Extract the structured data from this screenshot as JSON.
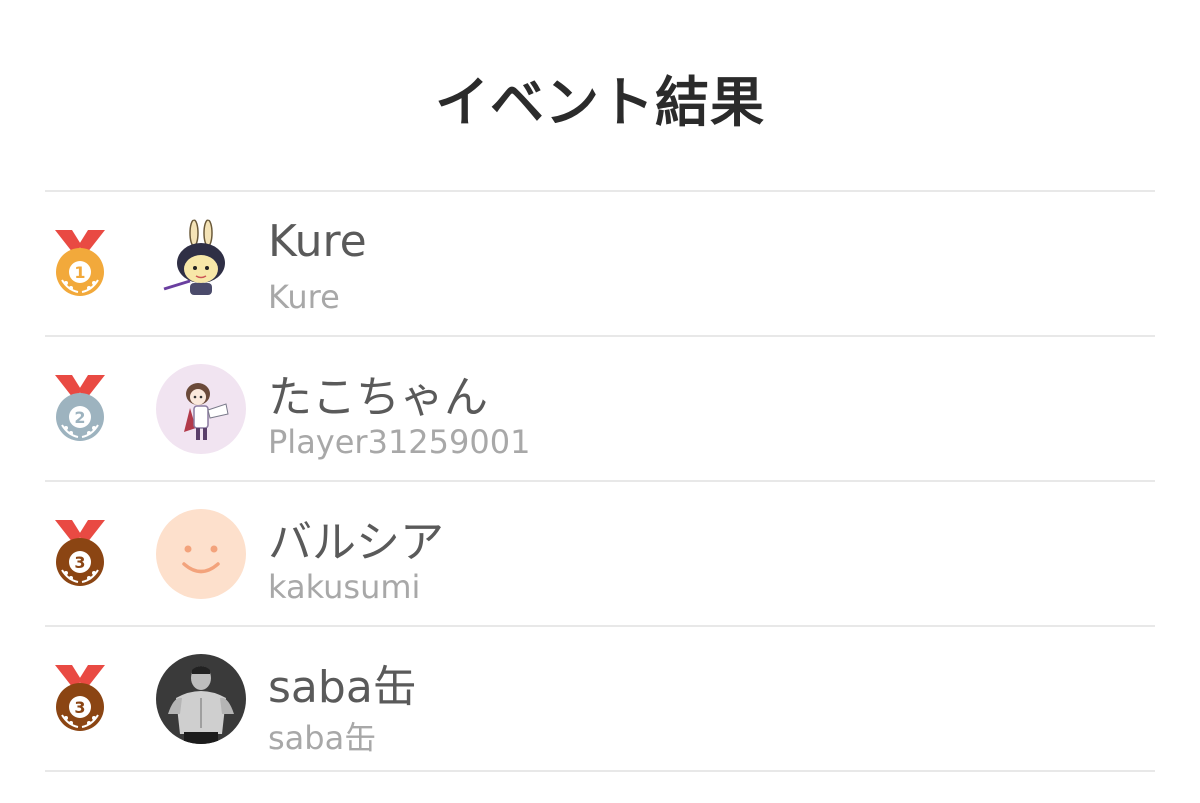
{
  "header": {
    "title": "イベント結果"
  },
  "results": [
    {
      "rank": "1",
      "medal": "gold-medal-icon",
      "medal_color": "#f2a93b",
      "name": "Kure",
      "username": "Kure",
      "avatar": "chibi-bunny-ears-avatar"
    },
    {
      "rank": "2",
      "medal": "silver-medal-icon",
      "medal_color": "#9db3bf",
      "name": "たこちゃん",
      "username": "Player31259001",
      "avatar": "anime-girl-avatar"
    },
    {
      "rank": "3",
      "medal": "bronze-medal-icon",
      "medal_color": "#8b4513",
      "name": "バルシア",
      "username": "kakusumi",
      "avatar": "smiley-face-avatar"
    },
    {
      "rank": "3",
      "medal": "bronze-medal-icon",
      "medal_color": "#8b4513",
      "name": "saba缶",
      "username": "saba缶",
      "avatar": "muscular-man-photo-avatar"
    }
  ]
}
